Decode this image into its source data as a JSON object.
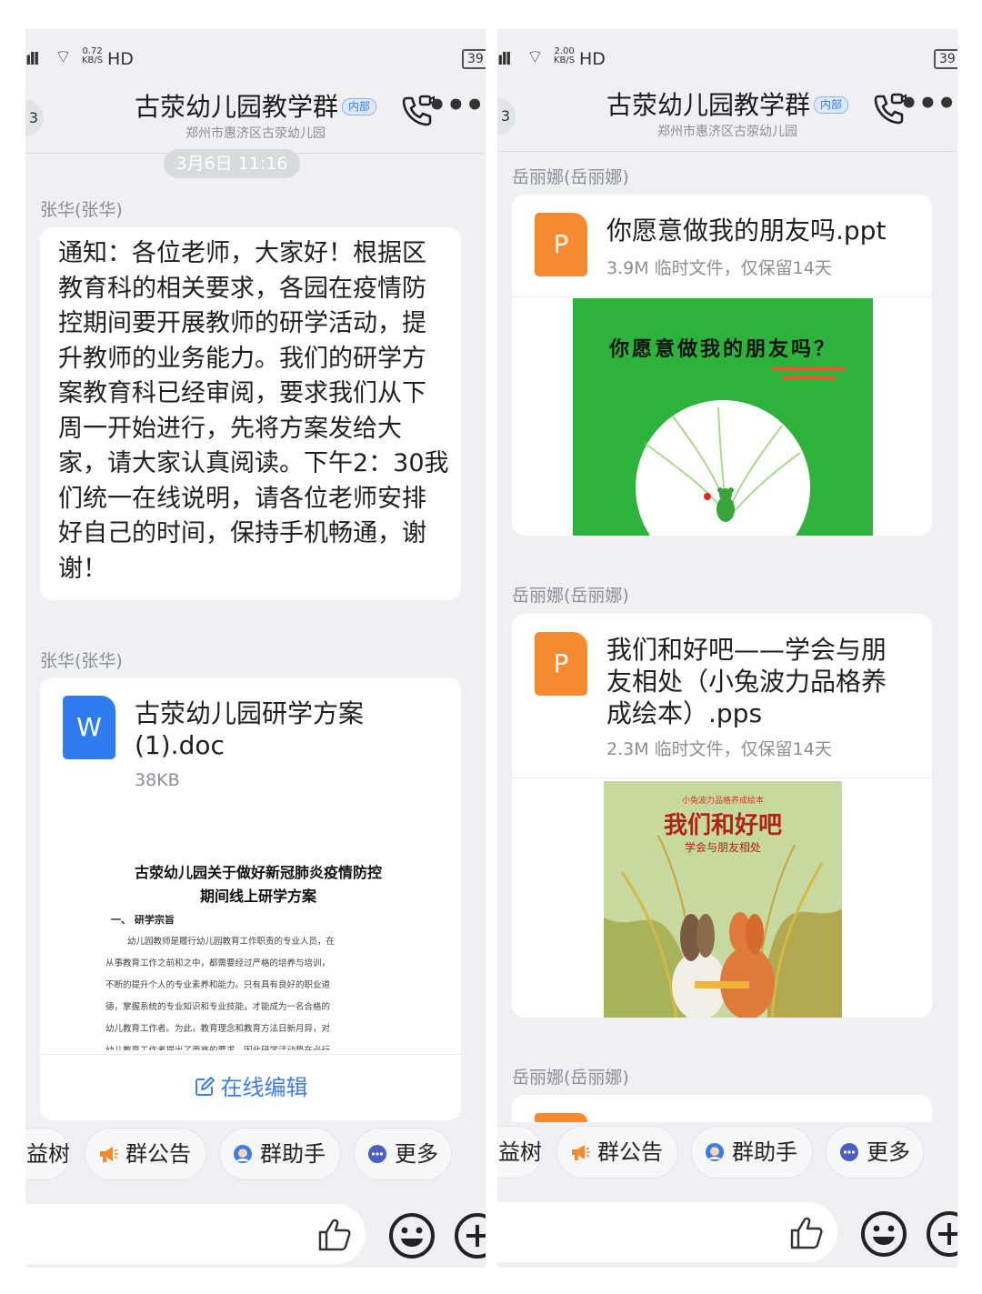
{
  "status_left": {
    "speed_top": "0.72",
    "speed_bottom": "KB/S",
    "hd": "HD",
    "battery": "39"
  },
  "status_right": {
    "speed_top": "2.00",
    "speed_bottom": "KB/S",
    "hd": "HD",
    "battery": "39"
  },
  "header": {
    "back_count": "3",
    "title": "古荥幼儿园教学群",
    "tag": "内部",
    "subtitle": "郑州市惠济区古荥幼儿园"
  },
  "left": {
    "time": "3月6日 11:16",
    "msg1": {
      "sender": "张华(张华)",
      "text": "通知：各位老师，大家好！根据区教育科的相关要求，各园在疫情防控期间要开展教师的研学活动，提升教师的业务能力。我们的研学方案教育科已经审阅，要求我们从下周一开始进行，先将方案发给大家，请大家认真阅读。下午2：30我们统一在线说明，请各位老师安排好自己的时间，保持手机畅通，谢谢！"
    },
    "msg2": {
      "sender": "张华(张华)",
      "file_icon": "W",
      "file_name_1": "古荥幼儿园研学方案",
      "file_name_2": "(1).doc",
      "file_size": "38KB",
      "doc_title_1": "古荥幼儿园关于做好新冠肺炎疫情防控",
      "doc_title_2": "期间线上研学方案",
      "doc_section": "一、 研学宗旨",
      "doc_lines": [
        "幼儿园教师是履行幼儿园教育工作职责的专业人员，在",
        "从事教育工作之前和之中，都需要经过严格的培养与培训，",
        "不断的提升个人的专业素养和能力。只有具有良好的职业道",
        "德，掌握系统的专业知识和专业技能，才能成为一名合格的",
        "幼儿教育工作者。为此，教育理念和教育方法日新月异，对",
        "幼儿教育工作者提出了更高的要求，因此研学活动势在必行"
      ],
      "edit_label": "在线编辑"
    }
  },
  "right": {
    "msg1": {
      "sender": "岳丽娜(岳丽娜)",
      "file_icon": "P",
      "file_name": "你愿意做我的朋友吗.ppt",
      "file_meta": "3.9M 临时文件，仅保留14天",
      "cover_title": "你愿意做我的朋友吗？"
    },
    "msg2": {
      "sender": "岳丽娜(岳丽娜)",
      "file_icon": "P",
      "file_name_1": "我们和好吧——学会与朋",
      "file_name_2": "友相处（小兔波力品格养",
      "file_name_3": "成绘本）.pps",
      "file_meta": "2.3M 临时文件，仅保留14天",
      "cover_series": "小兔波力品格养成绘本",
      "cover_title": "我们和好吧",
      "cover_subtitle": "学会与朋友相处"
    },
    "msg3": {
      "sender": "岳丽娜(岳丽娜)"
    }
  },
  "toolbar": {
    "chip_partial": "益树",
    "announcement": "群公告",
    "assistant": "群助手",
    "more": "更多"
  },
  "colors": {
    "accent": "#3f7de6",
    "word_blue": "#2f7cf0",
    "ppt_orange": "#f58a30",
    "cover_green": "#2db23c",
    "background": "#eef0f4"
  },
  "icons": [
    "phone-call-icon",
    "more-dots-icon",
    "word-file-icon",
    "ppt-file-icon",
    "edit-icon",
    "megaphone-icon",
    "assistant-icon",
    "more-circle-icon",
    "thumbs-up-icon",
    "emoji-icon",
    "plus-icon"
  ]
}
